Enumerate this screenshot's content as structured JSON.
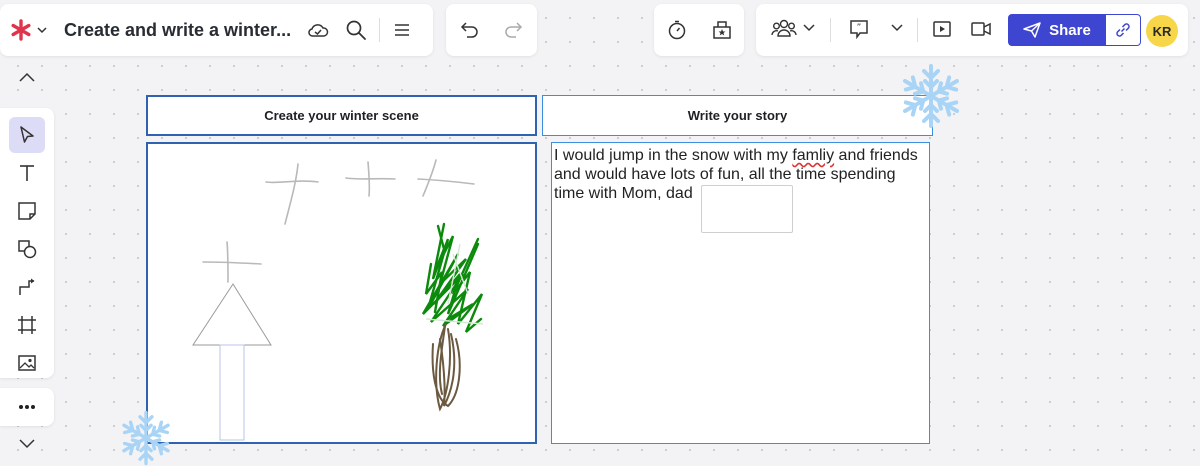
{
  "header": {
    "title": "Create and write a winter...",
    "logo_color": "#e0334c",
    "icons": [
      "asterisk-logo-icon",
      "chevron-down-icon",
      "cloud-saved-icon",
      "search-icon",
      "menu-icon"
    ]
  },
  "history": {
    "icons": [
      "undo-icon",
      "redo-icon"
    ]
  },
  "tools": {
    "icons": [
      "timer-icon",
      "voting-icon"
    ]
  },
  "collab": {
    "icons": [
      "collaborators-icon",
      "chevron-down-icon",
      "comment-icon",
      "chevron-down-icon",
      "present-icon",
      "video-icon"
    ],
    "share_label": "Share",
    "share_color": "#3d45d1",
    "avatar_initials": "KR",
    "avatar_color": "#f7d64a"
  },
  "left_toolbar": {
    "tools": [
      "collapse-up",
      "select",
      "text",
      "sticky-note",
      "shapes",
      "connector",
      "frame",
      "image",
      "more",
      "expand-down"
    ]
  },
  "board": {
    "scene_header": "Create your winter scene",
    "story_header": "Write your story",
    "story_parts": {
      "before": "I would jump in the snow with my ",
      "misspelled": "famliy",
      "after": " and friends and would have lots of fun, all the time spending time with Mom, dad"
    }
  },
  "colors": {
    "frame_border": "#2f63b1",
    "story_border": "#3b8de0",
    "tree_green": "#0b8a0b",
    "trunk_brown": "#6b5a40"
  }
}
